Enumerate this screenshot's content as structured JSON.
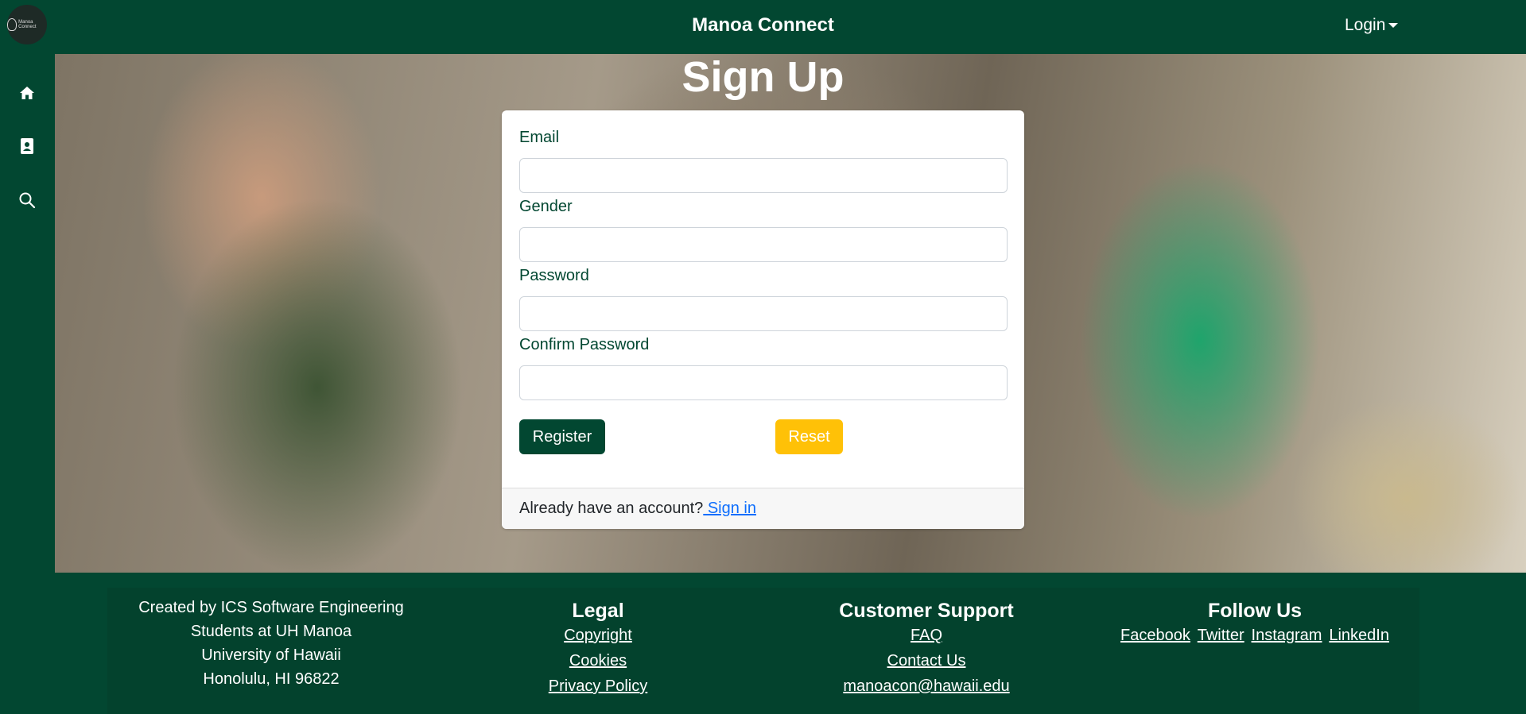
{
  "navbar": {
    "logo_text": "Manoa Connect",
    "brand": "Manoa Connect",
    "login_label": "Login"
  },
  "sidebar": {
    "icons": [
      "home-icon",
      "contact-book-icon",
      "search-icon"
    ]
  },
  "hero": {
    "title": "Sign Up"
  },
  "form": {
    "email_label": "Email",
    "email_value": "",
    "gender_label": "Gender",
    "gender_value": "",
    "password_label": "Password",
    "password_value": "",
    "confirm_label": "Confirm Password",
    "confirm_value": "",
    "register_label": "Register",
    "reset_label": "Reset",
    "footer_question": "Already have an account?",
    "signin_label": " Sign in"
  },
  "footer": {
    "about": [
      "Created by ICS Software Engineering",
      "Students at UH Manoa",
      "University of Hawaii",
      "Honolulu, HI 96822"
    ],
    "legal": {
      "title": "Legal",
      "links": [
        "Copyright",
        "Cookies",
        "Privacy Policy"
      ]
    },
    "support": {
      "title": "Customer Support",
      "links": [
        "FAQ",
        "Contact Us",
        "manoacon@hawaii.edu"
      ]
    },
    "follow": {
      "title": "Follow Us",
      "links": [
        "Facebook",
        "Twitter",
        "Instagram",
        "LinkedIn"
      ]
    }
  },
  "colors": {
    "brand_green": "#024731",
    "footer_green": "#03422d",
    "reset_yellow": "#ffc107",
    "link_blue": "#0d6efd"
  }
}
